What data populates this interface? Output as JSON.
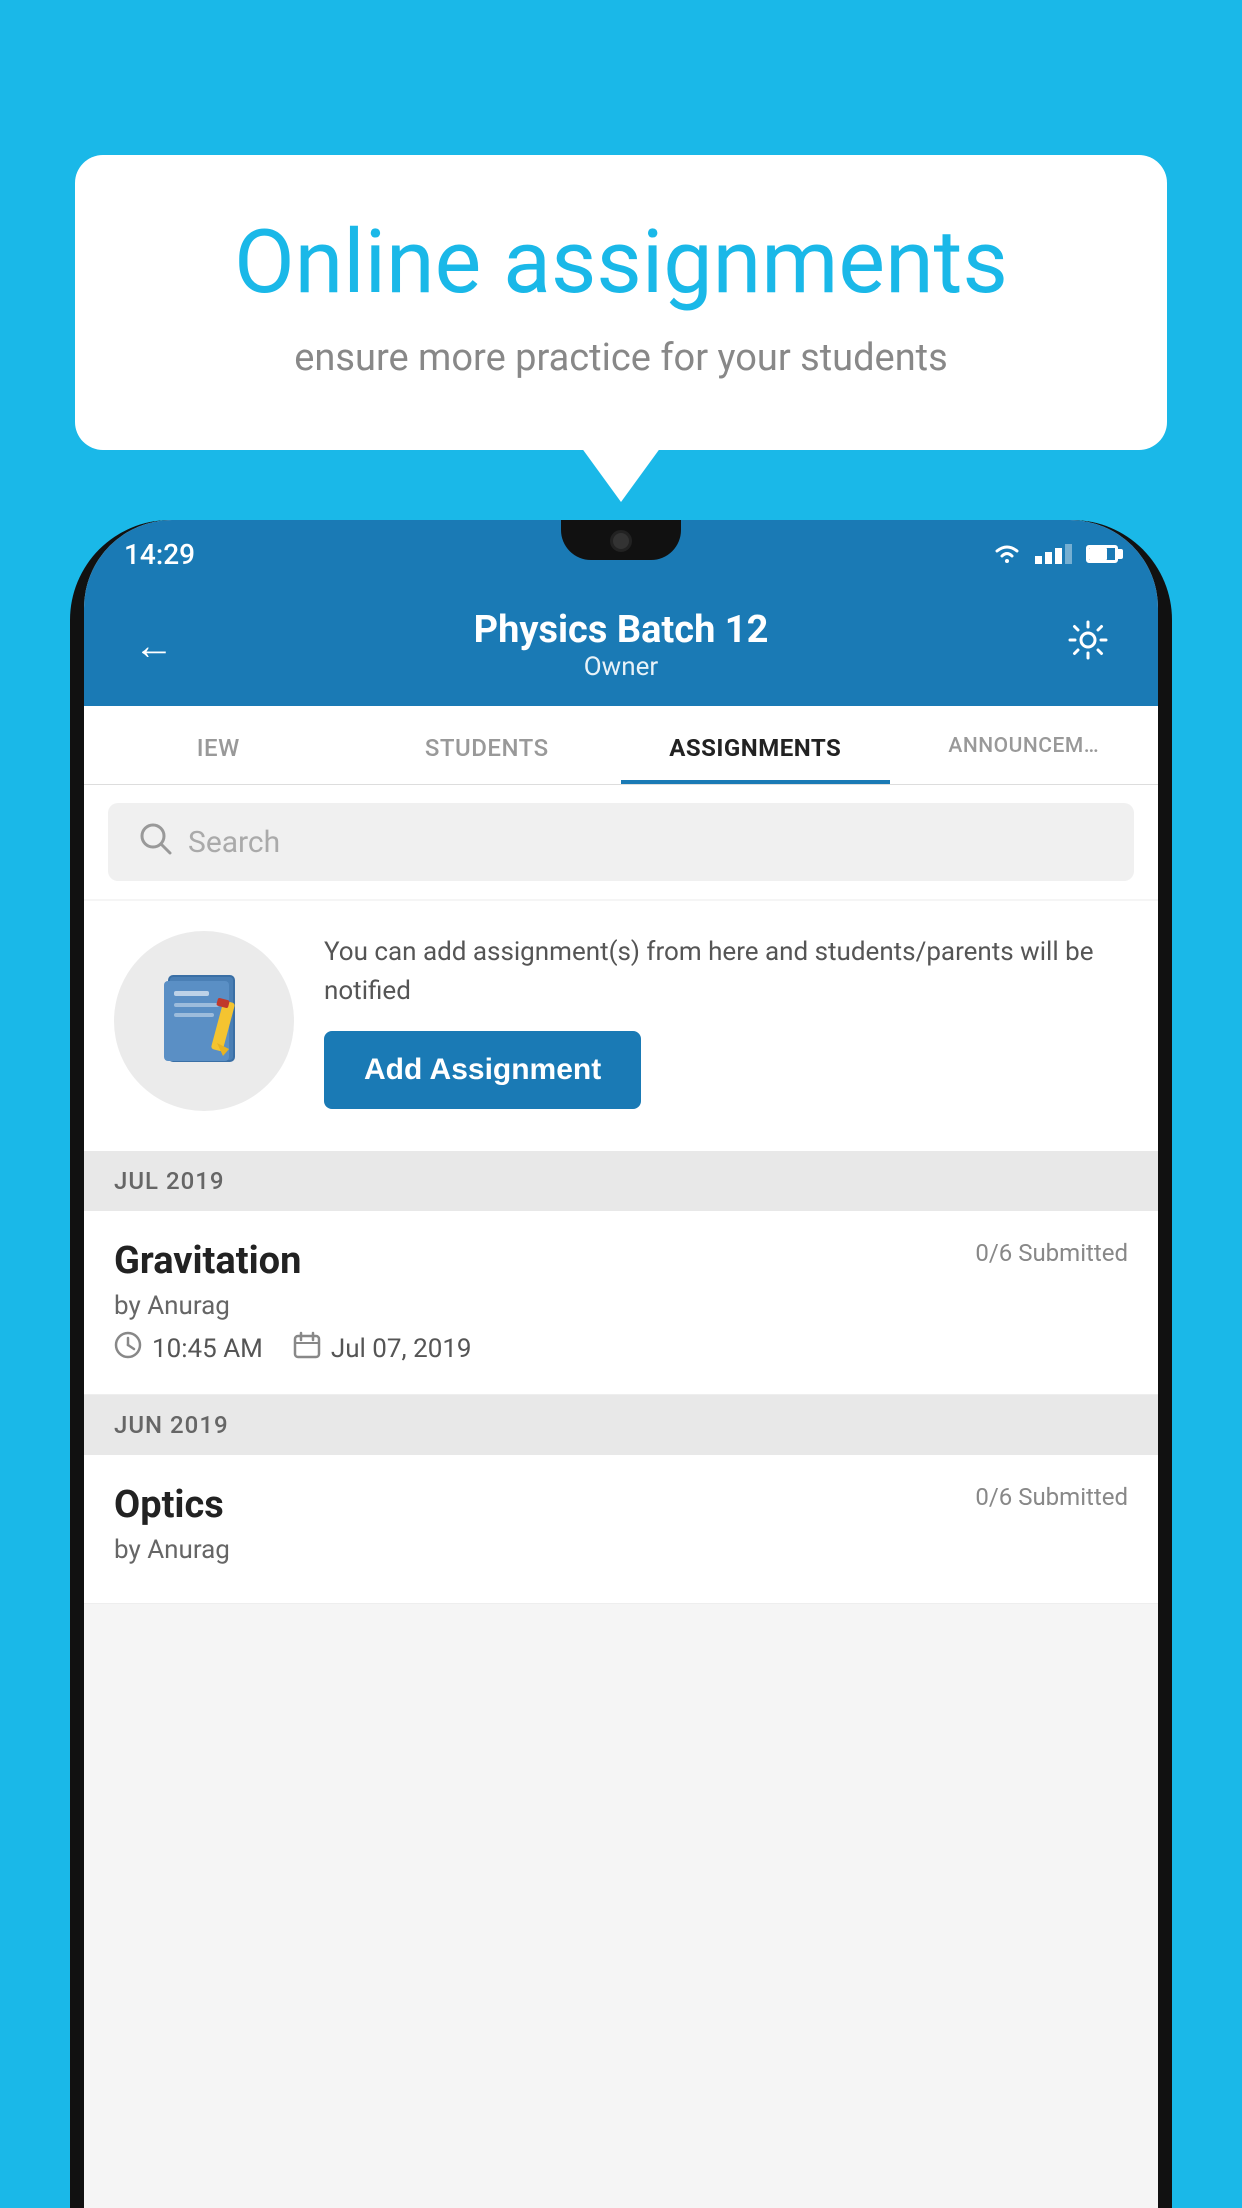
{
  "background_color": "#1AB8E8",
  "speech_bubble": {
    "title": "Online assignments",
    "subtitle": "ensure more practice for your students"
  },
  "status_bar": {
    "time": "14:29"
  },
  "app_header": {
    "title": "Physics Batch 12",
    "subtitle": "Owner"
  },
  "tabs": [
    {
      "label": "IEW",
      "active": false
    },
    {
      "label": "STUDENTS",
      "active": false
    },
    {
      "label": "ASSIGNMENTS",
      "active": true
    },
    {
      "label": "ANNOUNCEM…",
      "active": false
    }
  ],
  "search": {
    "placeholder": "Search"
  },
  "promo": {
    "text": "You can add assignment(s) from here and students/parents will be notified",
    "button_label": "Add Assignment"
  },
  "sections": [
    {
      "header": "JUL 2019",
      "assignments": [
        {
          "name": "Gravitation",
          "submitted": "0/6 Submitted",
          "by": "by Anurag",
          "time": "10:45 AM",
          "date": "Jul 07, 2019"
        }
      ]
    },
    {
      "header": "JUN 2019",
      "assignments": [
        {
          "name": "Optics",
          "submitted": "0/6 Submitted",
          "by": "by Anurag",
          "time": "",
          "date": ""
        }
      ]
    }
  ]
}
